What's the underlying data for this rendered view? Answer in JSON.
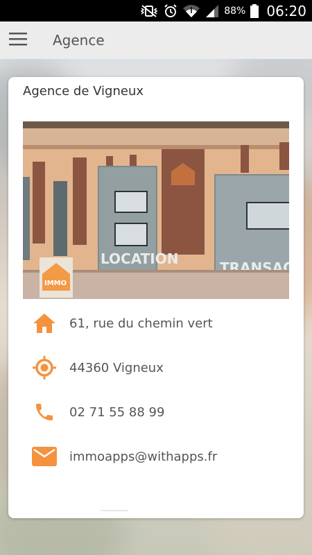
{
  "status_bar": {
    "battery_percent": "88%",
    "time": "06:20"
  },
  "app_bar": {
    "title": "Agence",
    "menu_icon": "hamburger-menu-icon"
  },
  "card": {
    "title": "Agence de Vigneux",
    "photo": {
      "logo_text": "IMMO",
      "sign_location": "LOCATION",
      "sign_transaction": "TRANSACT"
    },
    "info": [
      {
        "icon": "home-icon",
        "text": "61, rue du chemin vert"
      },
      {
        "icon": "location-target-icon",
        "text": "44360 Vigneux"
      },
      {
        "icon": "phone-icon",
        "text": "02 71 55 88 99"
      },
      {
        "icon": "email-icon",
        "text": "immoapps@withapps.fr"
      }
    ]
  },
  "colors": {
    "accent": "#f5923e",
    "status_bar": "#000000",
    "app_bar": "#ececec",
    "card": "#ffffff"
  }
}
